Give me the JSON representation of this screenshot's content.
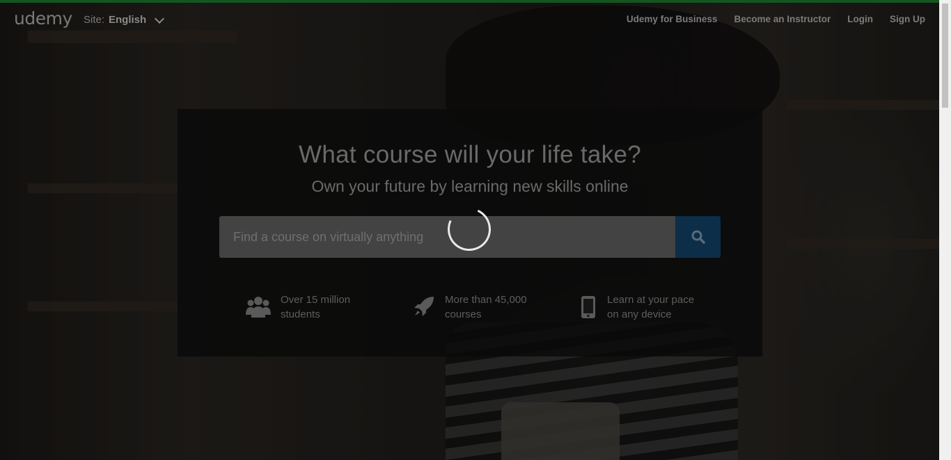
{
  "header": {
    "logo": "udemy",
    "site_label": "Site:",
    "site_value": "English",
    "nav": [
      {
        "label": "Udemy for Business"
      },
      {
        "label": "Become an Instructor"
      },
      {
        "label": "Login"
      },
      {
        "label": "Sign Up"
      }
    ]
  },
  "hero": {
    "title": "What course will your life take?",
    "subtitle": "Own your future by learning new skills online",
    "search": {
      "placeholder": "Find a course on virtually anything"
    },
    "features": [
      {
        "icon": "users-icon",
        "line1": "Over 15 million",
        "line2": "students"
      },
      {
        "icon": "rocket-icon",
        "line1": "More than 45,000",
        "line2": "courses"
      },
      {
        "icon": "mobile-icon",
        "line1": "Learn at your pace",
        "line2": "on any device"
      }
    ]
  },
  "colors": {
    "accent_bar": "#14561f",
    "search_button": "#0c2e49",
    "panel": "#0a0a0a"
  }
}
